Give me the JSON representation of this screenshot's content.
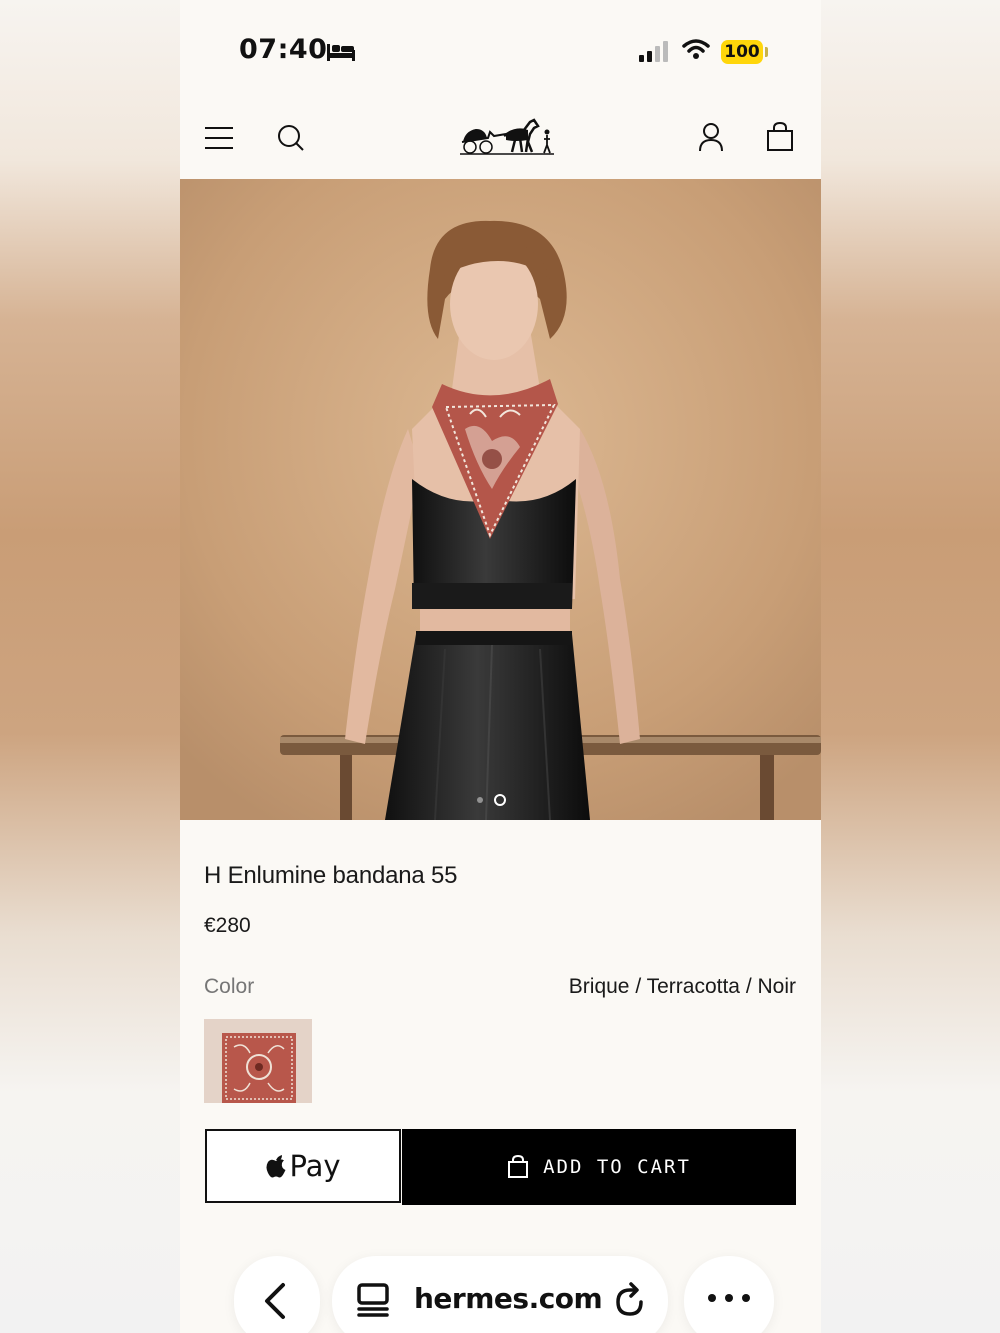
{
  "status_bar": {
    "time": "07:40",
    "battery": "100"
  },
  "header": {
    "brand": "Hermès"
  },
  "product": {
    "title": "H Enlumine bandana 55",
    "price": "€280",
    "color_label": "Color",
    "color_value": "Brique / Terracotta / Noir",
    "image_count": 2,
    "active_image_index": 2
  },
  "actions": {
    "apple_pay_label": "Pay",
    "add_to_cart_label": "ADD TO CART"
  },
  "browser": {
    "url": "hermes.com"
  },
  "colors": {
    "accent": "#000000",
    "battery": "#ffd60a",
    "hero_bg": "#cba27a",
    "scarf": "#b4564a",
    "page_bg": "#fbf9f5"
  }
}
